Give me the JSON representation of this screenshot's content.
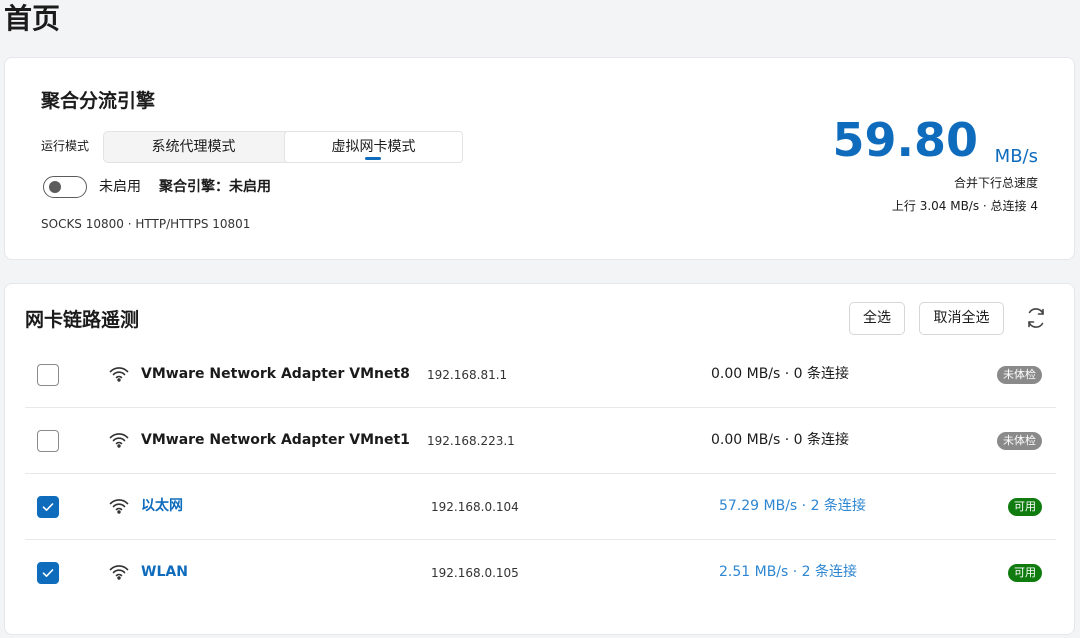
{
  "page": {
    "title": "首页"
  },
  "engine": {
    "title": "聚合分流引擎",
    "mode_label": "运行模式",
    "modes": [
      "系统代理模式",
      "虚拟网卡模式"
    ],
    "toggle_label": "未启用",
    "status": "聚合引擎：未启用",
    "ports": "SOCKS 10800 · HTTP/HTTPS 10801",
    "speed_value": "59.80",
    "speed_unit": "MB/s",
    "speed_caption": "合并下行总速度",
    "speed_sub": "上行 3.04 MB/s · 总连接 4"
  },
  "nic": {
    "title": "网卡链路遥测",
    "select_all": "全选",
    "deselect_all": "取消全选",
    "rows": [
      {
        "name": "VMware Network Adapter VMnet8",
        "ip": "192.168.81.1",
        "rate": "0.00 MB/s · 0 条连接",
        "badge": "未体检",
        "checked": false
      },
      {
        "name": "VMware Network Adapter VMnet1",
        "ip": "192.168.223.1",
        "rate": "0.00 MB/s · 0 条连接",
        "badge": "未体检",
        "checked": false
      },
      {
        "name": "以太网",
        "ip": "192.168.0.104",
        "rate": "57.29 MB/s · 2 条连接",
        "badge": "可用",
        "checked": true
      },
      {
        "name": "WLAN",
        "ip": "192.168.0.105",
        "rate": "2.51 MB/s · 2 条连接",
        "badge": "可用",
        "checked": true
      }
    ]
  },
  "colors": {
    "accent": "#0f6cbd",
    "ok": "#107c10",
    "neutral": "#8a8a8a"
  },
  "icons": {
    "wifi": "wifi-icon",
    "refresh": "refresh-icon",
    "check": "check-icon"
  }
}
